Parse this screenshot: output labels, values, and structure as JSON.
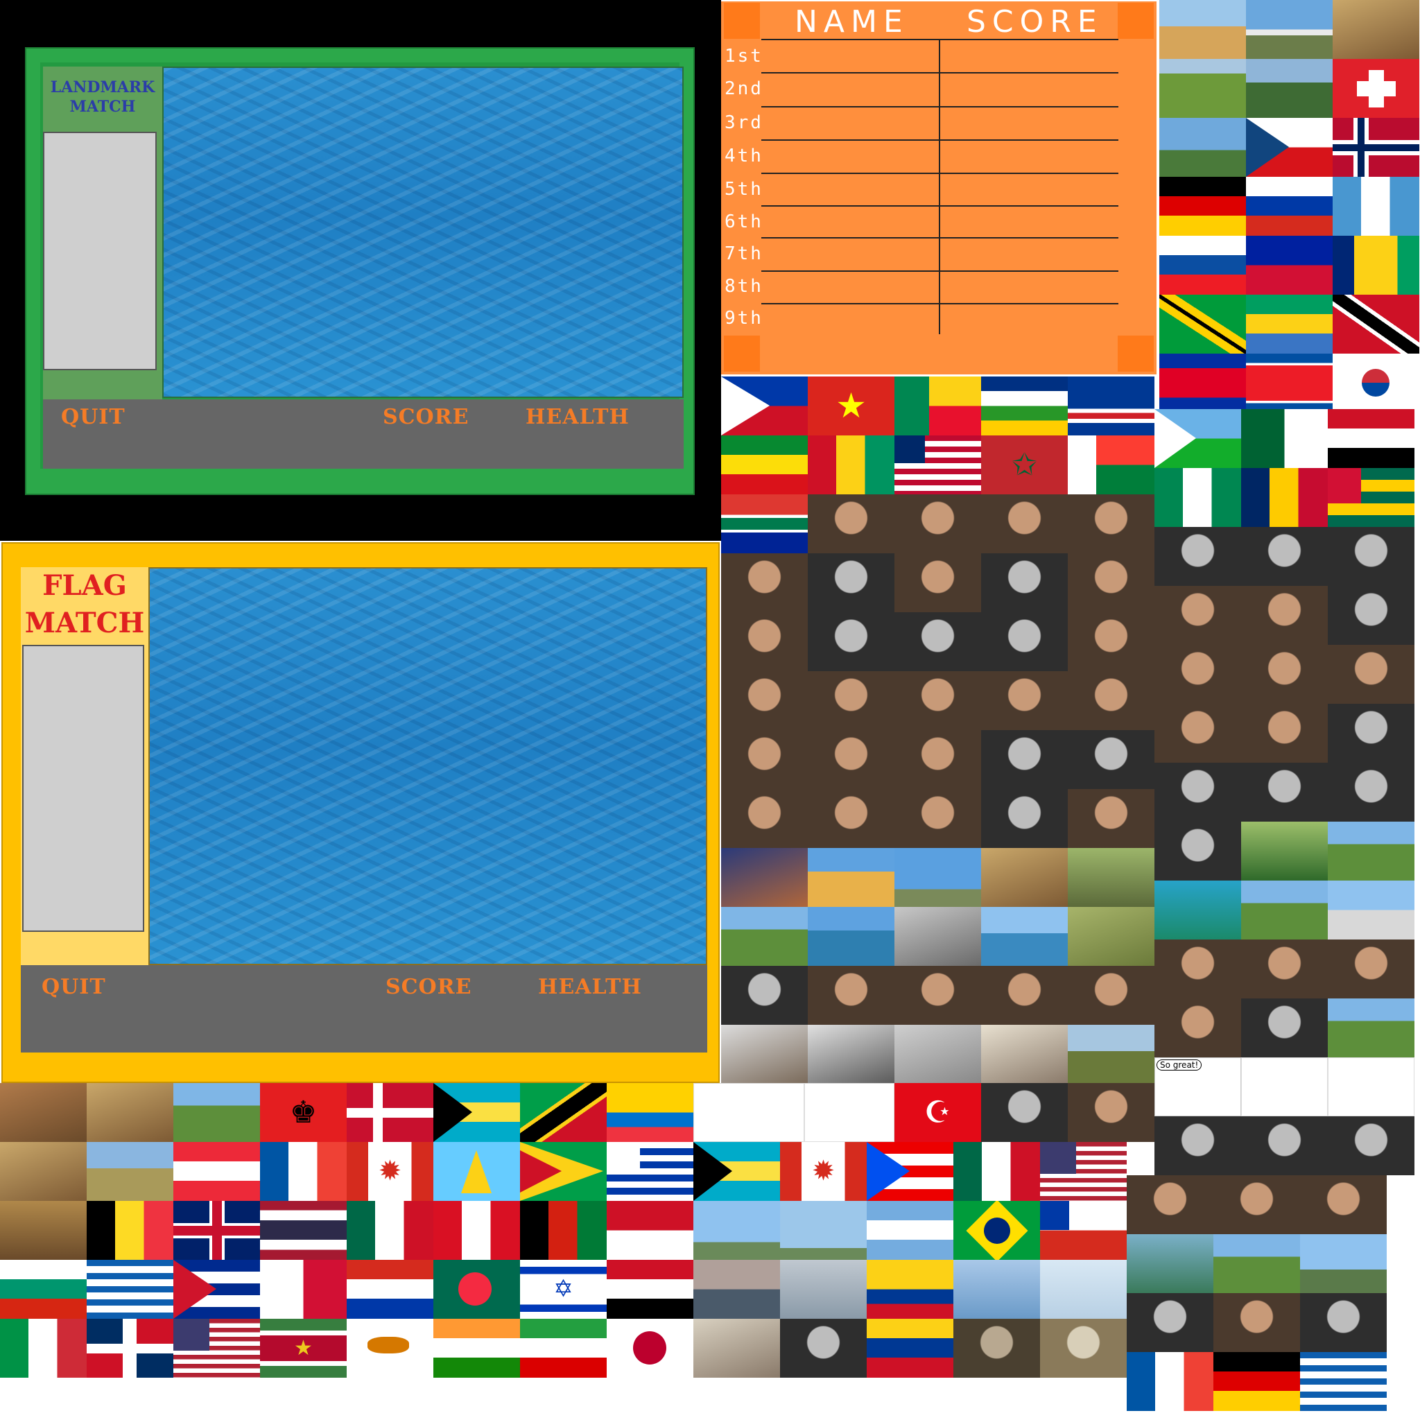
{
  "landmark_game": {
    "title_line1": "LANDMARK",
    "title_line2": "MATCH",
    "quit_label": "QUIT",
    "score_label": "SCORE",
    "health_label": "HEALTH",
    "colors": {
      "frame": "#2ca84a",
      "panel": "#5fa05a",
      "bar": "#666666",
      "text": "#f57c26",
      "title": "#2b3da8"
    }
  },
  "flag_game": {
    "title_line1": "FLAG",
    "title_line2": "MATCH",
    "quit_label": "QUIT",
    "score_label": "SCORE",
    "health_label": "HEALTH",
    "colors": {
      "frame": "#ffc000",
      "panel": "#ffd966",
      "bar": "#666666",
      "text": "#f57c26",
      "title": "#e02020"
    }
  },
  "scoreboard": {
    "name_header": "NAME",
    "score_header": "SCORE",
    "ranks": [
      "1st",
      "2nd",
      "3rd",
      "4th",
      "5th",
      "6th",
      "7th",
      "8th",
      "9th"
    ],
    "colors": {
      "board": "#ff8f3d",
      "corner": "#ff7a1a"
    }
  },
  "sprites": {
    "speech_bubble": "So great!"
  }
}
